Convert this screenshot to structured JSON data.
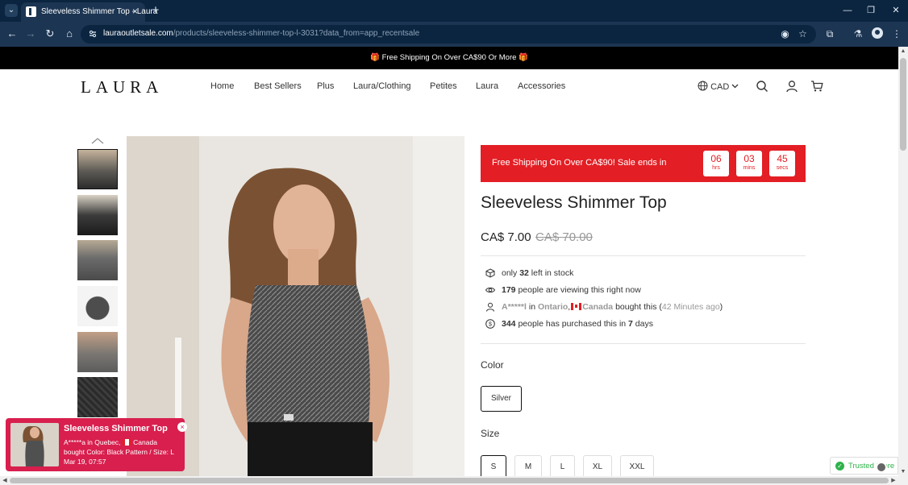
{
  "browser": {
    "tab_title": "Sleeveless Shimmer Top - Laura",
    "new_tab_label": "+",
    "url_domain": "lauraoutletsale.com",
    "url_path": "/products/sleeveless-shimmer-top-l-3031?data_from=app_recentsale"
  },
  "announcement": {
    "text": "Free Shipping On Over CA$90 Or More",
    "gift_icon": "🎁"
  },
  "header": {
    "logo": "LAURA",
    "nav": [
      "Home",
      "Best Sellers",
      "Plus",
      "Laura/Clothing",
      "Petites",
      "Laura",
      "Accessories"
    ],
    "currency": "CAD"
  },
  "promo": {
    "text": "Free Shipping On Over CA$90!  Sale ends in",
    "hours": "06",
    "hours_unit": "hrs",
    "mins": "03",
    "mins_unit": "mins",
    "secs": "45",
    "secs_unit": "secs"
  },
  "product": {
    "title": "Sleeveless Shimmer Top",
    "price": "CA$ 7.00",
    "compare_price": "CA$ 70.00"
  },
  "stats": {
    "stock_pre": "only ",
    "stock_count": "32",
    "stock_post": " left in stock",
    "viewers_count": "179",
    "viewers_post": " people are viewing this right now",
    "buyer_name": "A*****l",
    "buyer_in": " in ",
    "buyer_region": "Ontario",
    "buyer_sep": ",",
    "buyer_country": "Canada",
    "buyer_bought": " bought this (",
    "buyer_time": "42 Minutes ago",
    "buyer_close": ")",
    "purchased_count": "344",
    "purchased_mid": " people has purchased this in ",
    "purchased_days": "7",
    "purchased_post": " days"
  },
  "options": {
    "color_label": "Color",
    "color_value": "Silver",
    "size_label": "Size",
    "sizes": [
      "S",
      "M",
      "L",
      "XL",
      "XXL"
    ]
  },
  "toast": {
    "title": "Sleeveless Shimmer Top",
    "line1_pre": "A*****a in Quebec, ",
    "line1_post": " Canada",
    "line2": "bought Color: Black Pattern / Size: L",
    "line3": "Mar 19, 07:57",
    "close": "×"
  },
  "trusted": {
    "text": "Trusted Store"
  },
  "colors": {
    "promo_red": "#e31e24",
    "toast_pink": "#d81f4e",
    "trusted_green": "#2eb24a",
    "browser_dark": "#0b2540"
  }
}
